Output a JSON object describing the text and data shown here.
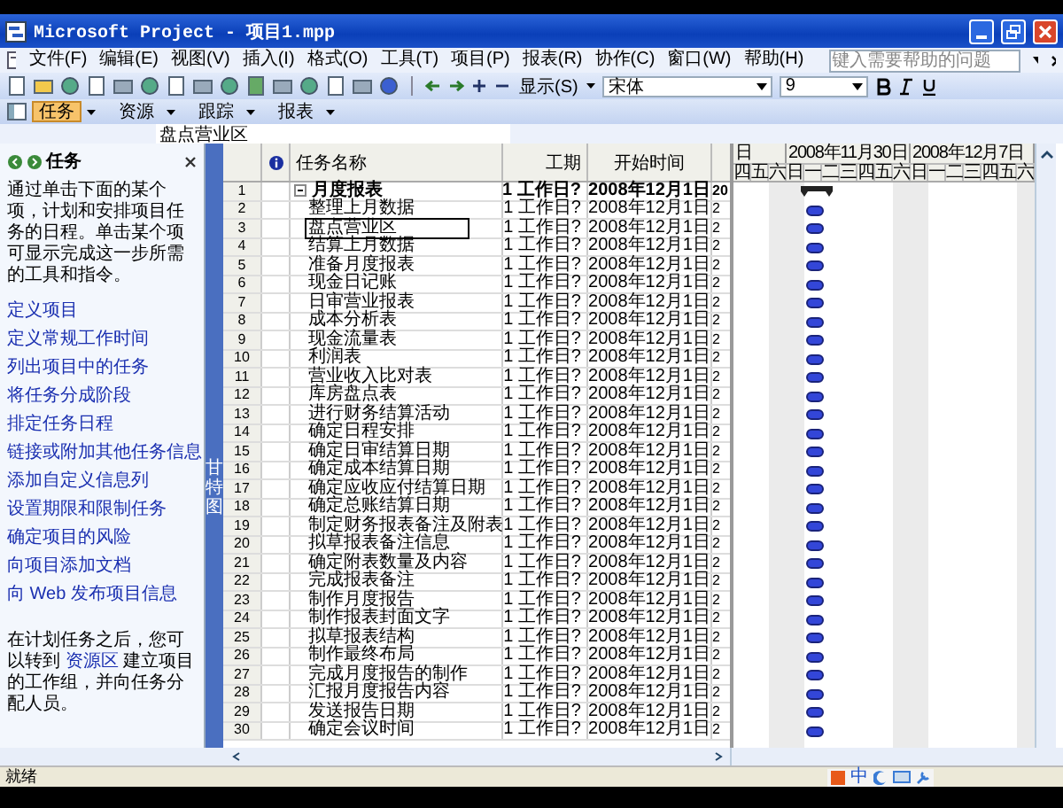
{
  "window": {
    "title": "Microsoft Project - 项目1.mpp"
  },
  "menu": [
    "文件(F)",
    "编辑(E)",
    "视图(V)",
    "插入(I)",
    "格式(O)",
    "工具(T)",
    "项目(P)",
    "报表(R)",
    "协作(C)",
    "窗口(W)",
    "帮助(H)"
  ],
  "help_box": {
    "placeholder": "键入需要帮助的问题"
  },
  "toolbar": {
    "view_menu": "显示(S)",
    "font": "宋体",
    "font_size": "9"
  },
  "guide_bar": [
    {
      "label": "任务",
      "selected": true
    },
    {
      "label": "资源",
      "selected": false
    },
    {
      "label": "跟踪",
      "selected": false
    },
    {
      "label": "报表",
      "selected": false
    }
  ],
  "entry_bar": {
    "value": "盘点营业区"
  },
  "task_pane": {
    "title": "任务",
    "intro": "通过单击下面的某个项，计划和安排项目任务的日程。单击某个项可显示完成这一步所需的工具和指令。",
    "links": [
      "定义项目",
      "定义常规工作时间",
      "列出项目中的任务",
      "将任务分成阶段",
      "排定任务日程",
      "链接或附加其他任务信息",
      "添加自定义信息列",
      "设置期限和限制任务",
      "确定项目的风险",
      "向项目添加文档",
      "向 Web 发布项目信息"
    ],
    "footer_before": "在计划任务之后，您可以转到",
    "footer_link": "资源区",
    "footer_after": "建立项目的工作组，并向任务分配人员。"
  },
  "view_bar": {
    "label": "甘特图"
  },
  "table": {
    "columns": [
      "任务名称",
      "工期",
      "开始时间"
    ],
    "rows": [
      {
        "id": "1",
        "name": "月度报表",
        "kind": "summary",
        "expanded": true,
        "duration": "1 工作日?",
        "start": "2008年12月1日",
        "column_5": "20",
        "selected": false
      },
      {
        "id": "2",
        "name": "整理上月数据",
        "kind": "task",
        "duration": "1 工作日?",
        "start": "2008年12月1日",
        "column_5": "2",
        "selected": false
      },
      {
        "id": "3",
        "name": "盘点营业区",
        "kind": "task",
        "duration": "1 工作日?",
        "start": "2008年12月1日",
        "column_5": "2",
        "selected": true
      },
      {
        "id": "4",
        "name": "结算上月数据",
        "kind": "task",
        "duration": "1 工作日?",
        "start": "2008年12月1日",
        "column_5": "2",
        "selected": false
      },
      {
        "id": "5",
        "name": "准备月度报表",
        "kind": "task",
        "duration": "1 工作日?",
        "start": "2008年12月1日",
        "column_5": "2",
        "selected": false
      },
      {
        "id": "6",
        "name": "现金日记账",
        "kind": "task",
        "duration": "1 工作日?",
        "start": "2008年12月1日",
        "column_5": "2",
        "selected": false
      },
      {
        "id": "7",
        "name": "日审营业报表",
        "kind": "task",
        "duration": "1 工作日?",
        "start": "2008年12月1日",
        "column_5": "2",
        "selected": false
      },
      {
        "id": "8",
        "name": "成本分析表",
        "kind": "task",
        "duration": "1 工作日?",
        "start": "2008年12月1日",
        "column_5": "2",
        "selected": false
      },
      {
        "id": "9",
        "name": "现金流量表",
        "kind": "task",
        "duration": "1 工作日?",
        "start": "2008年12月1日",
        "column_5": "2",
        "selected": false
      },
      {
        "id": "10",
        "name": "利润表",
        "kind": "task",
        "duration": "1 工作日?",
        "start": "2008年12月1日",
        "column_5": "2",
        "selected": false
      },
      {
        "id": "11",
        "name": "营业收入比对表",
        "kind": "task",
        "duration": "1 工作日?",
        "start": "2008年12月1日",
        "column_5": "2",
        "selected": false
      },
      {
        "id": "12",
        "name": "库房盘点表",
        "kind": "task",
        "duration": "1 工作日?",
        "start": "2008年12月1日",
        "column_5": "2",
        "selected": false
      },
      {
        "id": "13",
        "name": "进行财务结算活动",
        "kind": "task",
        "duration": "1 工作日?",
        "start": "2008年12月1日",
        "column_5": "2",
        "selected": false
      },
      {
        "id": "14",
        "name": "确定日程安排",
        "kind": "task",
        "duration": "1 工作日?",
        "start": "2008年12月1日",
        "column_5": "2",
        "selected": false
      },
      {
        "id": "15",
        "name": "确定日审结算日期",
        "kind": "task",
        "duration": "1 工作日?",
        "start": "2008年12月1日",
        "column_5": "2",
        "selected": false
      },
      {
        "id": "16",
        "name": "确定成本结算日期",
        "kind": "task",
        "duration": "1 工作日?",
        "start": "2008年12月1日",
        "column_5": "2",
        "selected": false
      },
      {
        "id": "17",
        "name": "确定应收应付结算日期",
        "kind": "task",
        "duration": "1 工作日?",
        "start": "2008年12月1日",
        "column_5": "2",
        "selected": false
      },
      {
        "id": "18",
        "name": "确定总账结算日期",
        "kind": "task",
        "duration": "1 工作日?",
        "start": "2008年12月1日",
        "column_5": "2",
        "selected": false
      },
      {
        "id": "19",
        "name": "制定财务报表备注及附表",
        "kind": "task",
        "duration": "1 工作日?",
        "start": "2008年12月1日",
        "column_5": "2",
        "selected": false
      },
      {
        "id": "20",
        "name": "拟草报表备注信息",
        "kind": "task",
        "duration": "1 工作日?",
        "start": "2008年12月1日",
        "column_5": "2",
        "selected": false
      },
      {
        "id": "21",
        "name": "确定附表数量及内容",
        "kind": "task",
        "duration": "1 工作日?",
        "start": "2008年12月1日",
        "column_5": "2",
        "selected": false
      },
      {
        "id": "22",
        "name": "完成报表备注",
        "kind": "task",
        "duration": "1 工作日?",
        "start": "2008年12月1日",
        "column_5": "2",
        "selected": false
      },
      {
        "id": "23",
        "name": "制作月度报告",
        "kind": "task",
        "duration": "1 工作日?",
        "start": "2008年12月1日",
        "column_5": "2",
        "selected": false
      },
      {
        "id": "24",
        "name": "制作报表封面文字",
        "kind": "task",
        "duration": "1 工作日?",
        "start": "2008年12月1日",
        "column_5": "2",
        "selected": false
      },
      {
        "id": "25",
        "name": "拟草报表结构",
        "kind": "task",
        "duration": "1 工作日?",
        "start": "2008年12月1日",
        "column_5": "2",
        "selected": false
      },
      {
        "id": "26",
        "name": "制作最终布局",
        "kind": "task",
        "duration": "1 工作日?",
        "start": "2008年12月1日",
        "column_5": "2",
        "selected": false
      },
      {
        "id": "27",
        "name": "完成月度报告的制作",
        "kind": "task",
        "duration": "1 工作日?",
        "start": "2008年12月1日",
        "column_5": "2",
        "selected": false
      },
      {
        "id": "28",
        "name": "汇报月度报告内容",
        "kind": "task",
        "duration": "1 工作日?",
        "start": "2008年12月1日",
        "column_5": "2",
        "selected": false
      },
      {
        "id": "29",
        "name": "发送报告日期",
        "kind": "task",
        "duration": "1 工作日?",
        "start": "2008年12月1日",
        "column_5": "2",
        "selected": false
      },
      {
        "id": "30",
        "name": "确定会议时间",
        "kind": "task",
        "duration": "1 工作日?",
        "start": "2008年12月1日",
        "column_5": "2",
        "selected": false
      }
    ]
  },
  "gantt": {
    "weeks": [
      "日",
      "2008年11月30日",
      "2008年12月7日"
    ],
    "days": [
      "四",
      "五",
      "六",
      "日",
      "一",
      "二",
      "三",
      "四",
      "五",
      "六",
      "日",
      "一",
      "二",
      "三",
      "四",
      "五",
      "六"
    ]
  },
  "status_bar": {
    "text": "就绪",
    "ime": "中"
  }
}
